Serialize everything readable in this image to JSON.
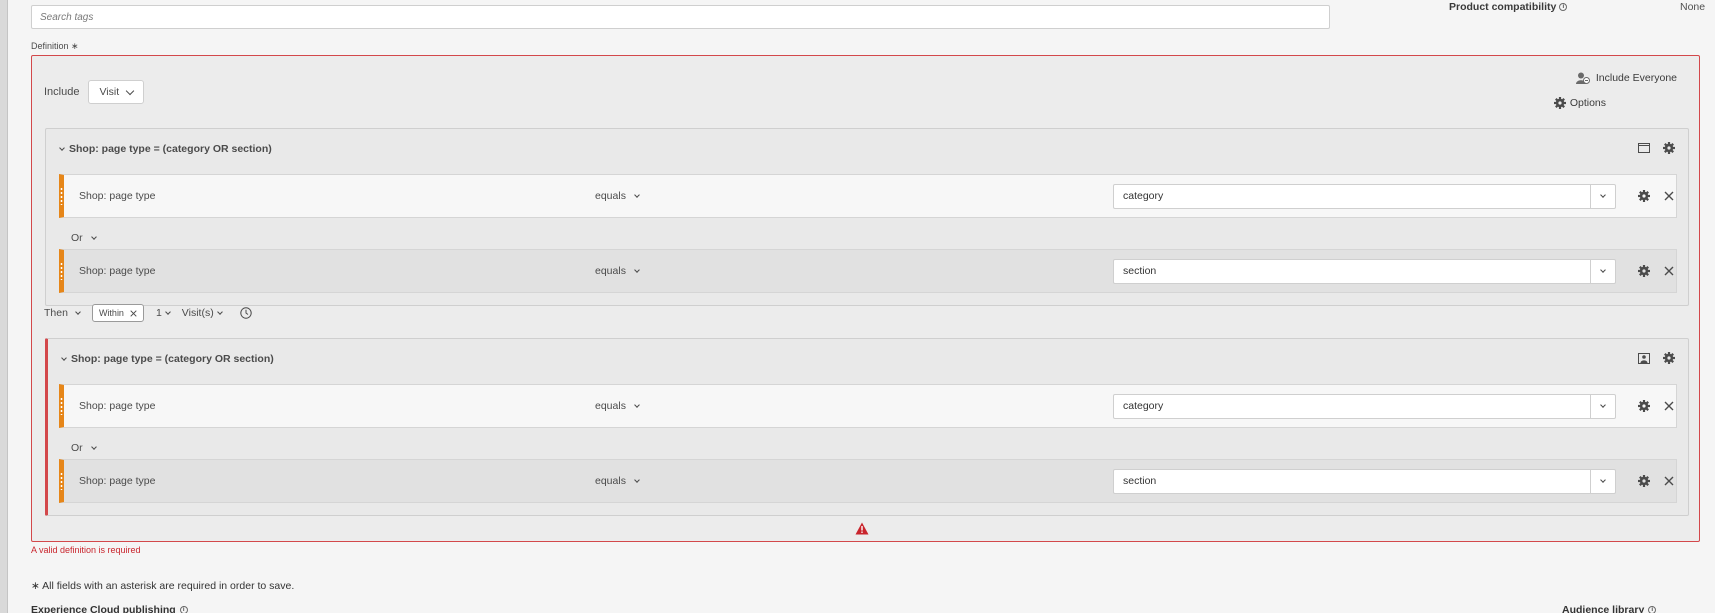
{
  "search": {
    "placeholder": "Search tags"
  },
  "product_compatibility": {
    "label": "Product compatibility",
    "value": "None"
  },
  "definition": {
    "label": "Definition ∗",
    "include_label": "Include",
    "scope": "Visit",
    "include_everyone": "Include Everyone",
    "options": "Options",
    "containers": [
      {
        "title": "Shop: page type = (category OR section)",
        "rules": [
          {
            "dimension": "Shop: page type",
            "operator": "equals",
            "value": "category"
          },
          {
            "dimension": "Shop: page type",
            "operator": "equals",
            "value": "section"
          }
        ],
        "connector": "Or"
      },
      {
        "title": "Shop: page type = (category OR section)",
        "rules": [
          {
            "dimension": "Shop: page type",
            "operator": "equals",
            "value": "category"
          },
          {
            "dimension": "Shop: page type",
            "operator": "equals",
            "value": "section"
          }
        ],
        "connector": "Or"
      }
    ],
    "then": {
      "label": "Then",
      "within_tag": "Within",
      "count": "1",
      "unit": "Visit(s)"
    },
    "error": "A valid definition is required"
  },
  "footer": {
    "asterisk_note": "∗ All fields with an asterisk are required in order to save.",
    "ec_publishing": "Experience Cloud publishing",
    "audience_library": "Audience library"
  },
  "colors": {
    "error": "#d3484b",
    "rule_accent": "#e68619"
  }
}
